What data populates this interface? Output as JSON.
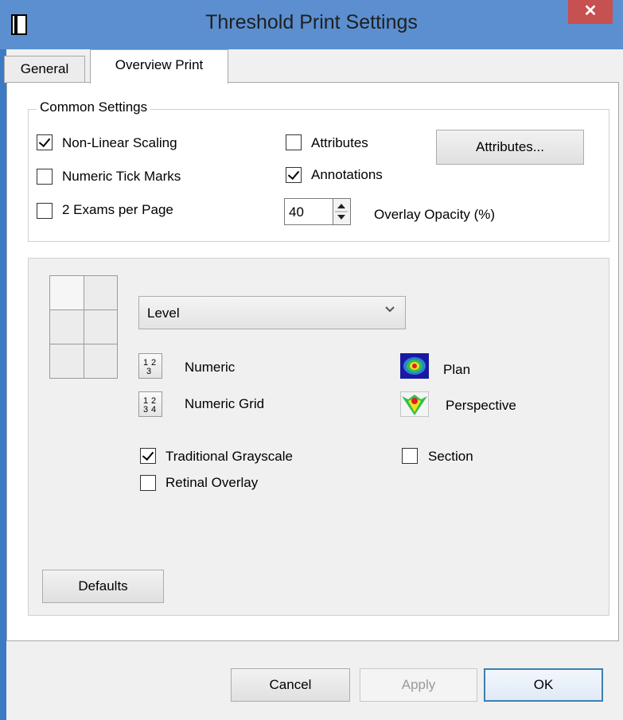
{
  "window": {
    "title": "Threshold Print Settings",
    "close_glyph": "✕"
  },
  "tabs": [
    {
      "label": "General",
      "active": false
    },
    {
      "label": "Overview Print",
      "active": true
    }
  ],
  "common_settings": {
    "label": "Common Settings",
    "non_linear_scaling": {
      "label": "Non-Linear Scaling",
      "checked": true
    },
    "numeric_tick_marks": {
      "label": "Numeric Tick Marks",
      "checked": false
    },
    "two_exams_per_page": {
      "label": "2 Exams per Page",
      "checked": false
    },
    "attributes_check": {
      "label": "Attributes",
      "checked": false
    },
    "annotations": {
      "label": "Annotations",
      "checked": true
    },
    "attributes_button": "Attributes...",
    "overlay_opacity": {
      "value": "40",
      "label": "Overlay Opacity (%)"
    }
  },
  "display": {
    "dropdown_value": "Level",
    "numeric": {
      "label": "Numeric",
      "icon_text": "1 2\n3"
    },
    "numeric_grid": {
      "label": "Numeric Grid",
      "icon_text": "1 2\n3 4"
    },
    "plan": {
      "label": "Plan"
    },
    "perspective": {
      "label": "Perspective"
    },
    "traditional_grayscale": {
      "label": "Traditional Grayscale",
      "checked": true
    },
    "retinal_overlay": {
      "label": "Retinal Overlay",
      "checked": false
    },
    "section": {
      "label": "Section",
      "checked": false
    },
    "defaults_button": "Defaults"
  },
  "footer": {
    "cancel": "Cancel",
    "apply": "Apply",
    "ok": "OK",
    "apply_enabled": false
  },
  "colors": {
    "titlebar": "#5b8fd0",
    "close": "#c75050",
    "ok_border": "#3c7fb1"
  }
}
